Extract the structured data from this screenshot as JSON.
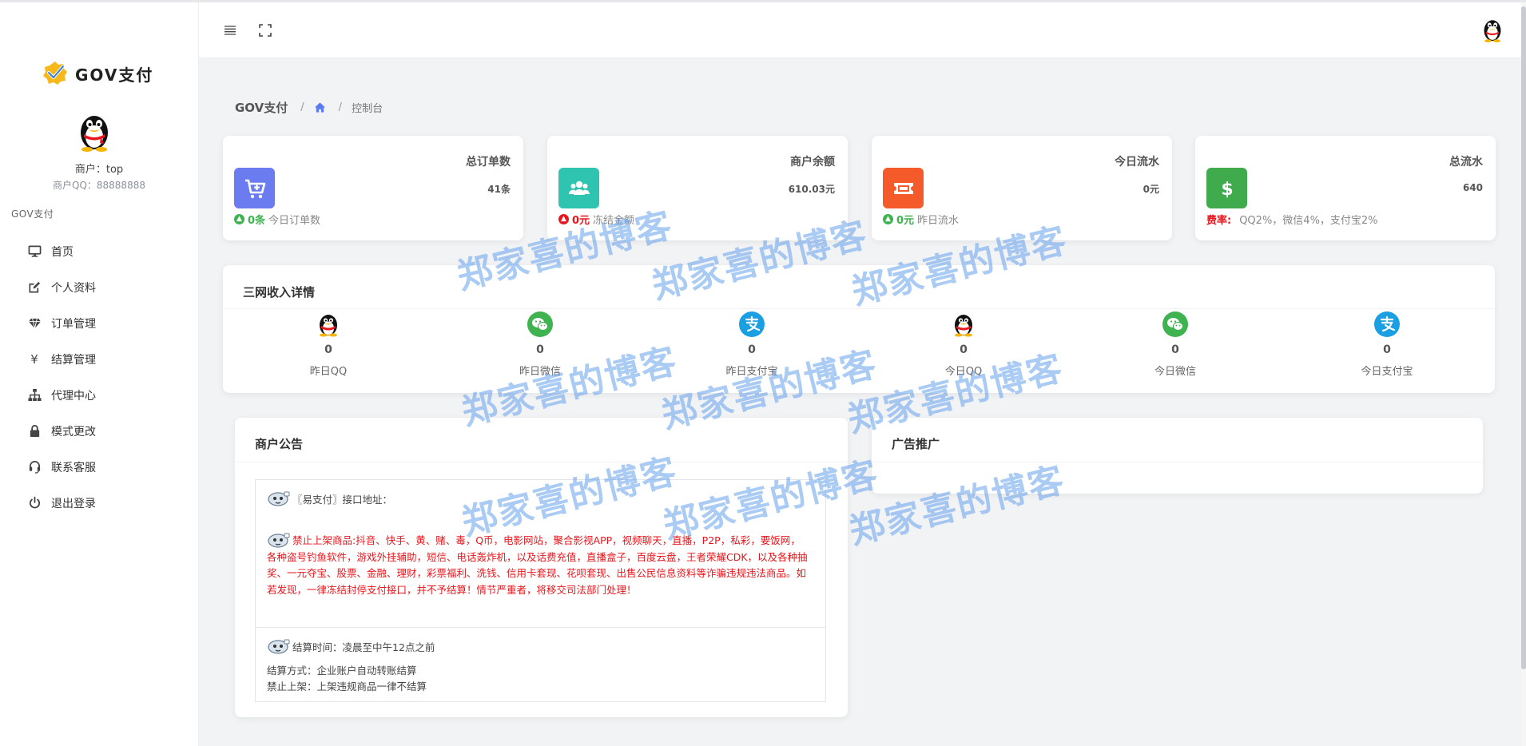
{
  "brand": {
    "name": "GOV支付"
  },
  "user": {
    "merchant": "商户：top",
    "qq": "商户QQ：88888888"
  },
  "sidebar": {
    "group": "GOV支付",
    "items": [
      {
        "label": "首页",
        "icon": "monitor-icon"
      },
      {
        "label": "个人资料",
        "icon": "edit-icon"
      },
      {
        "label": "订单管理",
        "icon": "diamond-icon"
      },
      {
        "label": "结算管理",
        "icon": "yen-icon"
      },
      {
        "label": "代理中心",
        "icon": "sitemap-icon"
      },
      {
        "label": "模式更改",
        "icon": "lock-icon"
      },
      {
        "label": "联系客服",
        "icon": "headset-icon"
      },
      {
        "label": "退出登录",
        "icon": "power-icon"
      }
    ]
  },
  "breadcrumb": {
    "root": "GOV支付",
    "current": "控制台"
  },
  "stats": [
    {
      "title": "总订单数",
      "value": "41条",
      "foot_amount": "0条",
      "foot_label": "今日订单数",
      "color": "#6a7cf0",
      "foot_color": "#3fb34f"
    },
    {
      "title": "商户余额",
      "value": "610.03元",
      "foot_amount": "0元",
      "foot_label": "冻结金额",
      "color": "#2ec4b0",
      "foot_color": "#e8161c"
    },
    {
      "title": "今日流水",
      "value": "0元",
      "foot_amount": "0元",
      "foot_label": "昨日流水",
      "color": "#f45a2a",
      "foot_color": "#3fb34f"
    },
    {
      "title": "总流水",
      "value": "640",
      "foot_amount": "费率:",
      "foot_label": "QQ2%，微信4%，支付宝2%",
      "color": "#3fab4d",
      "foot_color": "#e8161c"
    }
  ],
  "income": {
    "title": "三网收入详情",
    "items": [
      {
        "value": "0",
        "label": "昨日QQ",
        "icon": "qq-icon"
      },
      {
        "value": "0",
        "label": "昨日微信",
        "icon": "wechat-icon"
      },
      {
        "value": "0",
        "label": "昨日支付宝",
        "icon": "alipay-icon"
      },
      {
        "value": "0",
        "label": "今日QQ",
        "icon": "qq-icon"
      },
      {
        "value": "0",
        "label": "今日微信",
        "icon": "wechat-icon"
      },
      {
        "value": "0",
        "label": "今日支付宝",
        "icon": "alipay-icon"
      }
    ]
  },
  "notice": {
    "title": "商户公告",
    "line1": "〖易支付〗接口地址：",
    "red": "禁止上架商品:抖音、快手、黄、赌、毒，Q币，电影网站，聚合影视APP，视频聊天，直播，P2P，私彩，要饭网，各种盗号钓鱼软件，游戏外挂辅助，短信、电话轰炸机，以及话费充值，直播盒子，百度云盘，王者荣耀CDK，以及各种抽奖、一元夺宝、股票、金融、理财，彩票福利、洗钱、信用卡套现、花呗套现、出售公民信息资料等诈骗违规违法商品。如若发现，一律冻结封停支付接口，并不予结算！情节严重者，将移交司法部门处理！",
    "settle_time": "结算时间：凌晨至中午12点之前",
    "settle_method": "结算方式：企业账户自动转账结算",
    "ban": "禁止上架：上架违规商品一律不结算"
  },
  "ad": {
    "title": "广告推广"
  },
  "watermark": "郑家喜的博客"
}
